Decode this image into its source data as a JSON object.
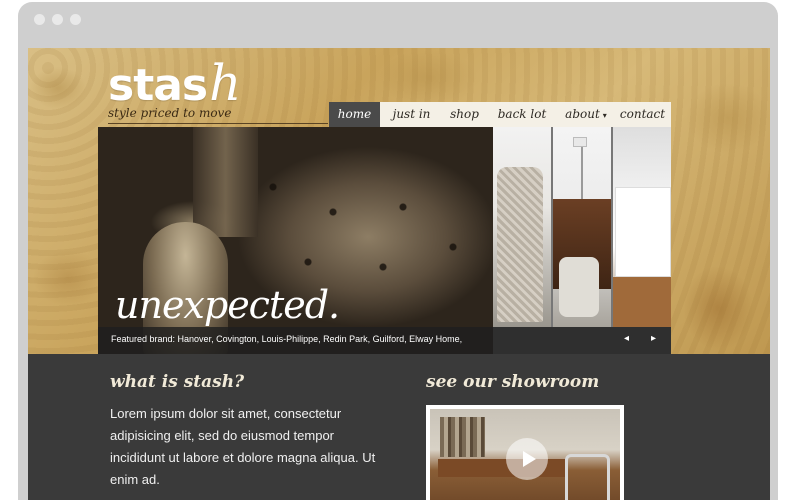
{
  "brand": {
    "logo_text": "stas",
    "logo_accent": "h",
    "tagline": "style priced to move"
  },
  "nav": {
    "items": [
      {
        "label": "home",
        "active": true
      },
      {
        "label": "just in"
      },
      {
        "label": "shop"
      },
      {
        "label": "back lot"
      },
      {
        "label": "about",
        "dropdown": true
      },
      {
        "label": "contact"
      }
    ]
  },
  "hero": {
    "headline": "unexpected.",
    "caption": "Featured brand: Hanover, Covington, Louis-Philippe, Redin Park, Guilford, Elway Home,",
    "prev_icon": "◂",
    "next_icon": "▸"
  },
  "about": {
    "title": "what is stash?",
    "body": "Lorem ipsum dolor sit amet, consectetur adipisicing elit, sed do eiusmod tempor incididunt ut labore et dolore magna aliqua. Ut enim ad."
  },
  "showroom": {
    "title": "see our showroom",
    "play_icon": "play-icon"
  },
  "colors": {
    "nav_active": "#4a4a4a",
    "content_bg": "#3a3a3a",
    "wallpaper": "#c9a45c"
  }
}
